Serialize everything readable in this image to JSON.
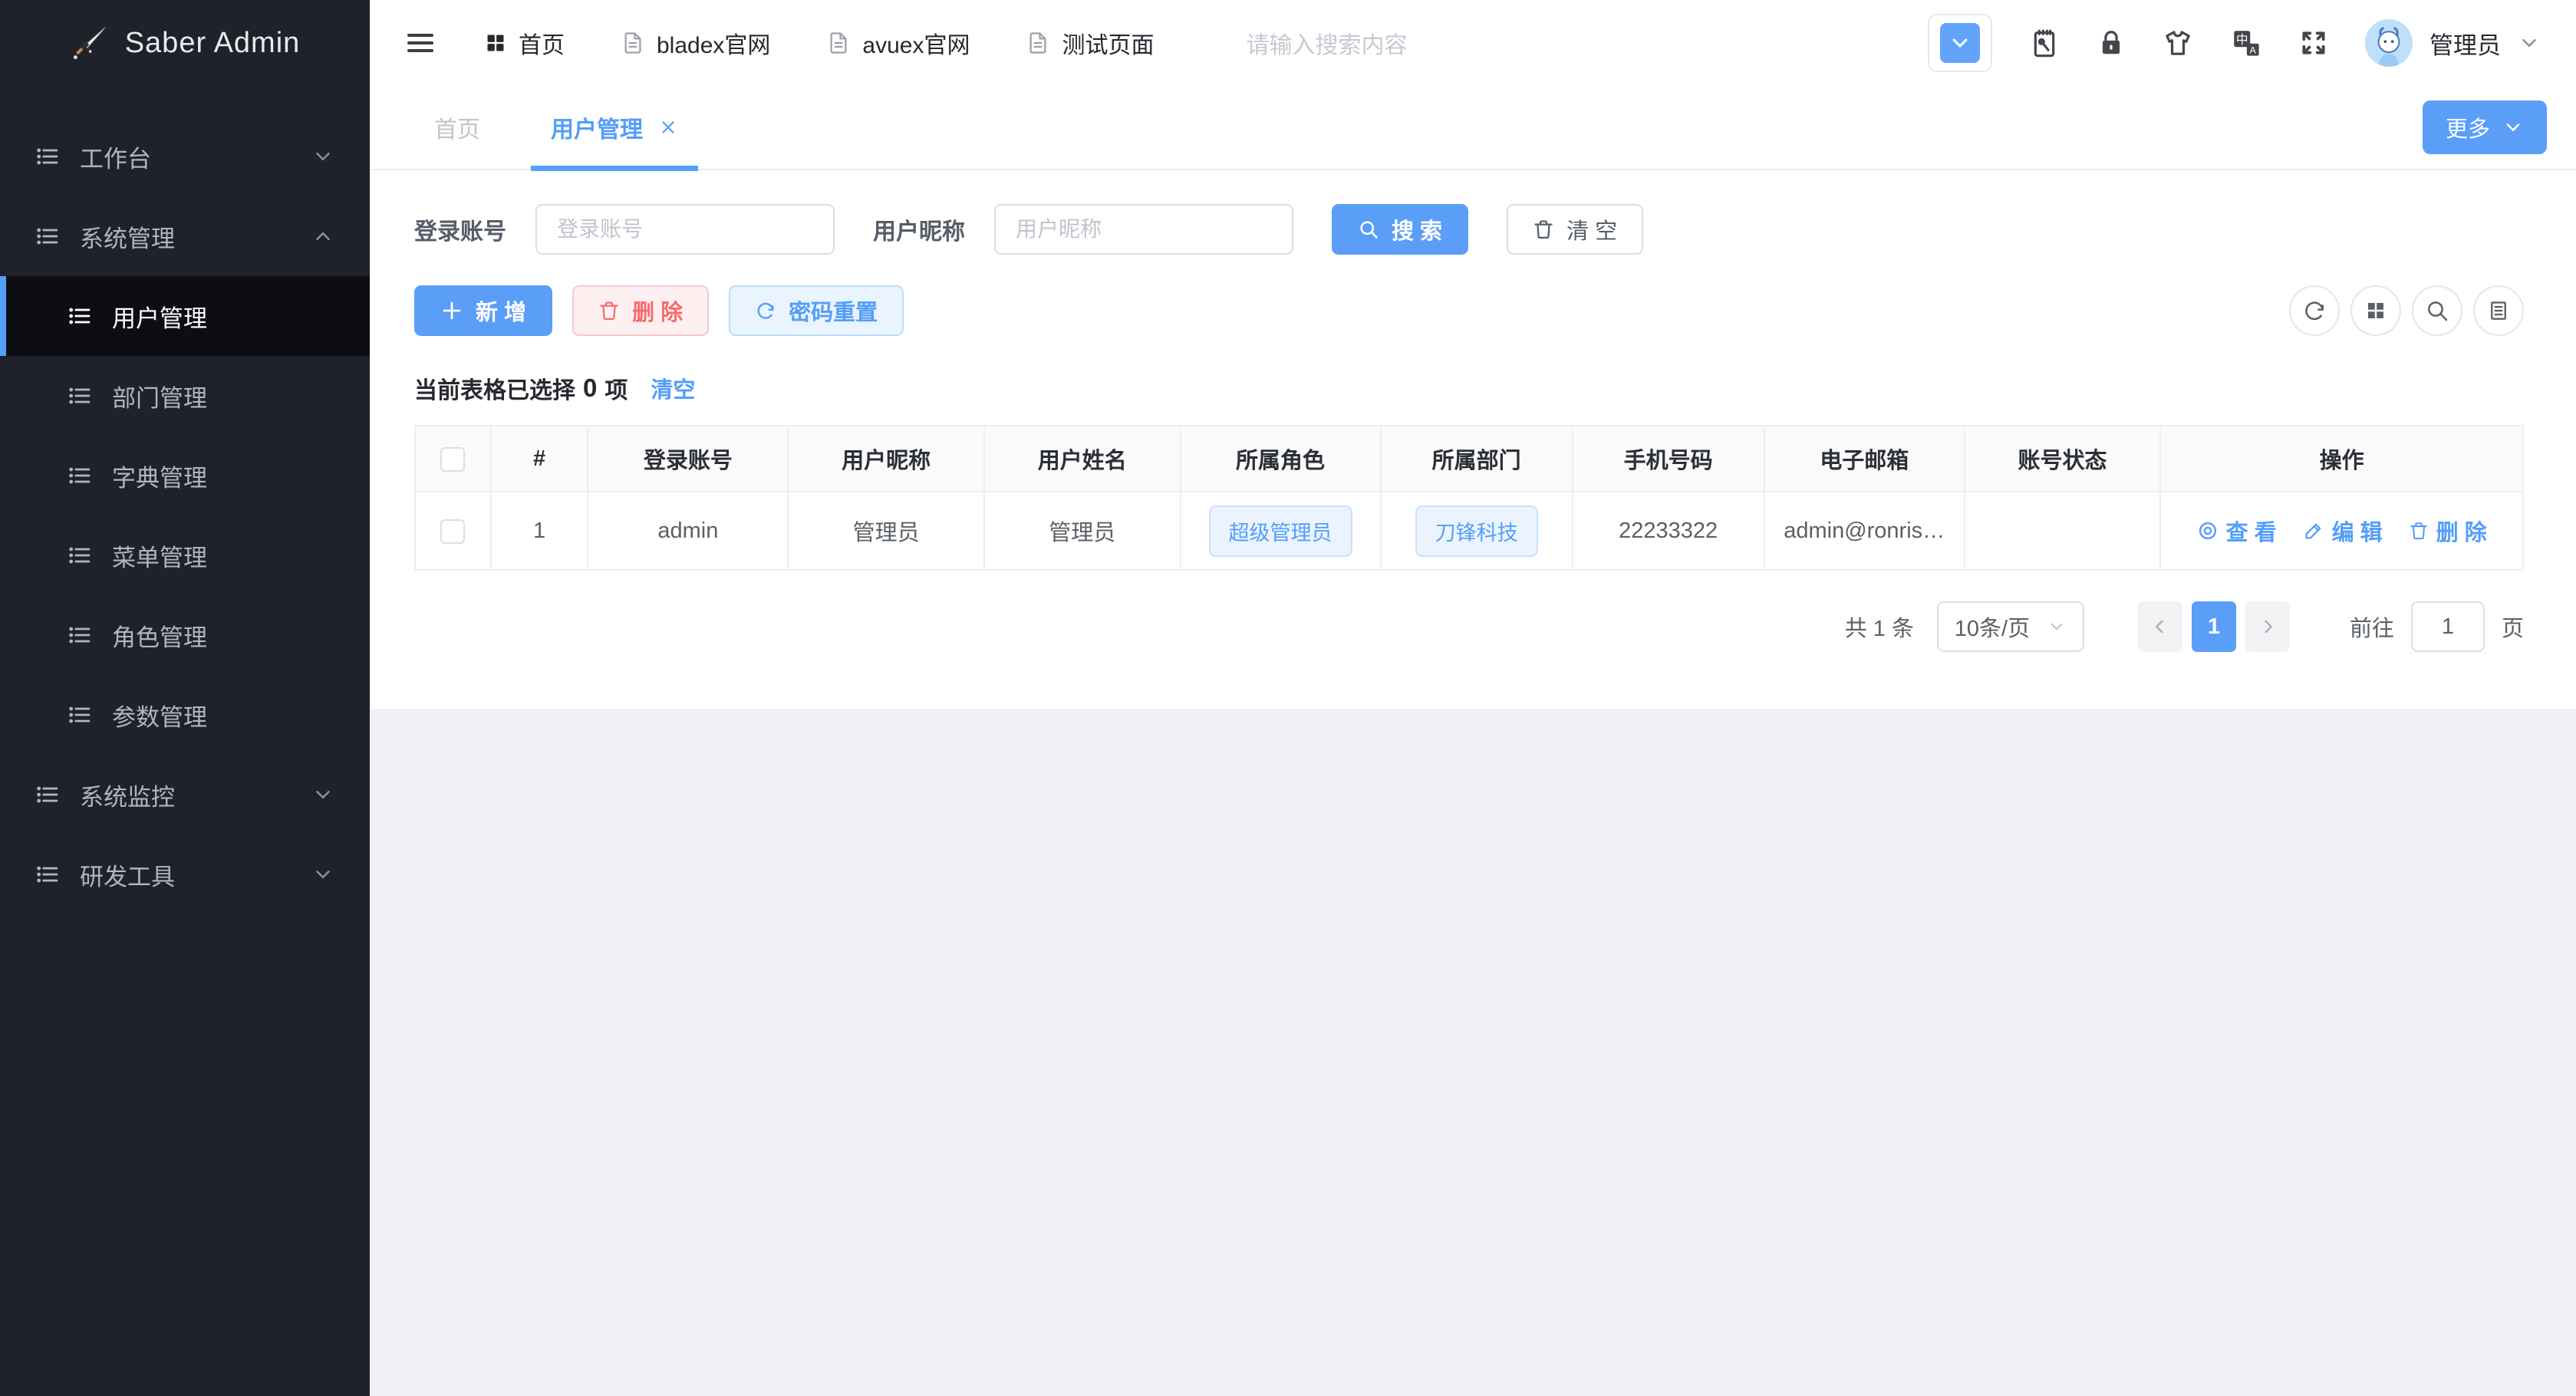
{
  "app": {
    "title": "Saber Admin"
  },
  "colors": {
    "accent": "#549EF8",
    "danger": "#F56C6C",
    "sidebar_bg": "#20222B",
    "sidebar_active_bg": "#0D0E13",
    "page_bg": "#EFF1F5",
    "tag_bg": "#EBF4FE",
    "table_border": "#EBEEF5"
  },
  "sidebar": {
    "groups": [
      {
        "label": "工作台",
        "state": "collapsed"
      },
      {
        "label": "系统管理",
        "state": "expanded"
      },
      {
        "label": "系统监控",
        "state": "collapsed"
      },
      {
        "label": "研发工具",
        "state": "collapsed"
      }
    ],
    "system_children": [
      {
        "label": "用户管理",
        "active": true
      },
      {
        "label": "部门管理"
      },
      {
        "label": "字典管理"
      },
      {
        "label": "菜单管理"
      },
      {
        "label": "角色管理"
      },
      {
        "label": "参数管理"
      }
    ]
  },
  "topbar": {
    "nav": [
      {
        "label": "首页",
        "icon": "grid-icon"
      },
      {
        "label": "bladex官网",
        "icon": "document-icon"
      },
      {
        "label": "avuex官网",
        "icon": "document-icon"
      },
      {
        "label": "测试页面",
        "icon": "document-icon"
      }
    ],
    "search_placeholder": "请输入搜索内容",
    "user": {
      "name": "管理员"
    }
  },
  "tabs": {
    "items": [
      {
        "label": "首页",
        "active": false
      },
      {
        "label": "用户管理",
        "active": true,
        "closable": true
      }
    ],
    "more_label": "更多"
  },
  "filters": {
    "account_label": "登录账号",
    "account_placeholder": "登录账号",
    "account_value": "",
    "nickname_label": "用户昵称",
    "nickname_placeholder": "用户昵称",
    "nickname_value": "",
    "search_label": "搜 索",
    "clear_label": "清 空"
  },
  "toolbar": {
    "add_label": "新 增",
    "delete_label": "删 除",
    "reset_password_label": "密码重置"
  },
  "selection": {
    "prefix": "当前表格已选择",
    "count": "0",
    "suffix": "项",
    "clear_label": "清空"
  },
  "table": {
    "columns": [
      "#",
      "登录账号",
      "用户昵称",
      "用户姓名",
      "所属角色",
      "所属部门",
      "手机号码",
      "电子邮箱",
      "账号状态",
      "操作"
    ],
    "rows": [
      {
        "index": "1",
        "account": "admin",
        "nickname": "管理员",
        "name": "管理员",
        "role_tag": "超级管理员",
        "dept_tag": "刀锋科技",
        "phone": "22233322",
        "email": "admin@ronris…",
        "status": "",
        "view_label": "查 看",
        "edit_label": "编 辑",
        "delete_label": "删 除"
      }
    ]
  },
  "pagination": {
    "total": "共 1 条",
    "page_size": "10条/页",
    "current_page": "1",
    "goto_prefix": "前往",
    "goto_value": "1",
    "goto_suffix": "页"
  }
}
